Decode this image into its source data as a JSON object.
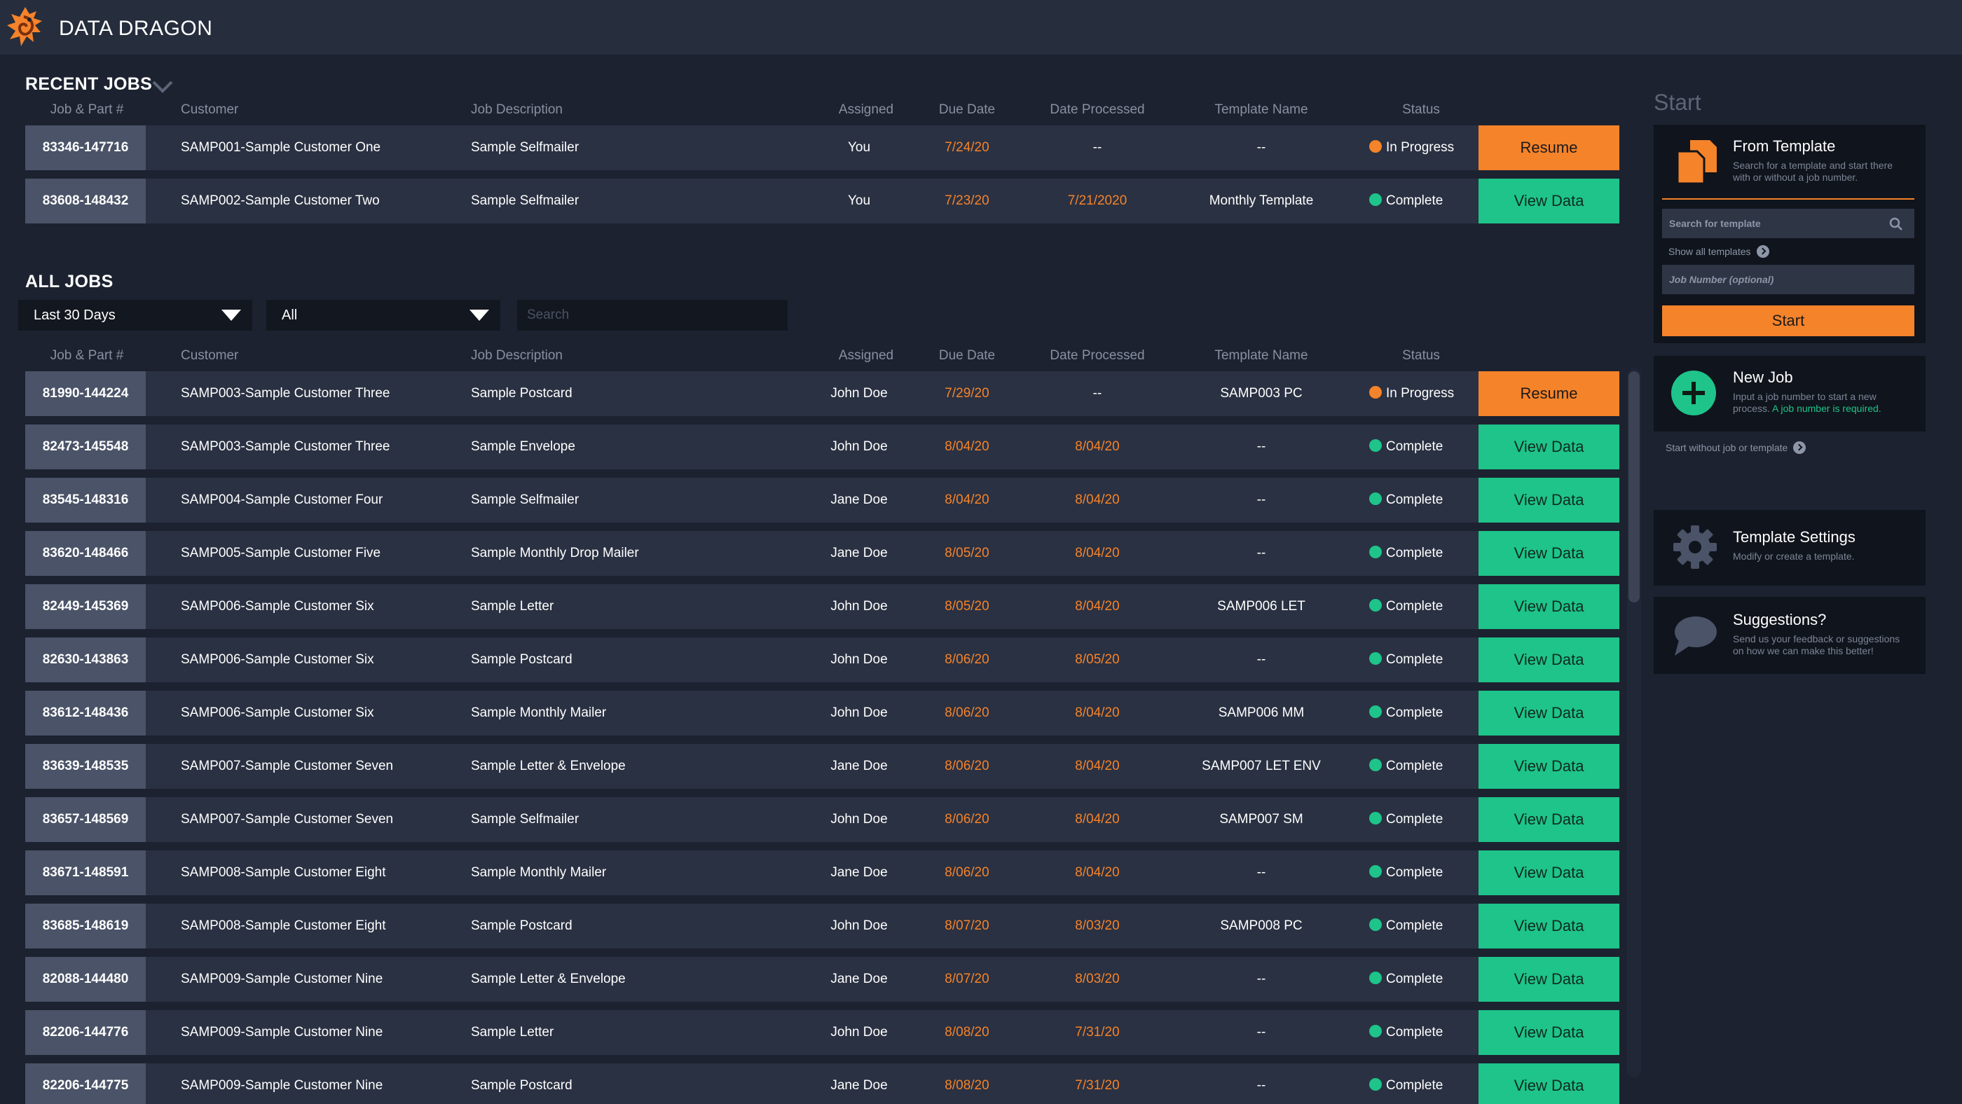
{
  "app": {
    "title": "DATA DRAGON"
  },
  "recent": {
    "title": "RECENT JOBS",
    "columns": [
      "Job & Part #",
      "Customer",
      "Job Description",
      "Assigned",
      "Due Date",
      "Date Processed",
      "Template Name",
      "Status"
    ],
    "rows": [
      {
        "job": "83346-147716",
        "customer": "SAMP001-Sample Customer One",
        "description": "Sample Selfmailer",
        "assigned": "You",
        "due": "7/24/20",
        "processed": "--",
        "template": "--",
        "status": "In Progress",
        "action": "Resume"
      },
      {
        "job": "83608-148432",
        "customer": "SAMP002-Sample Customer Two",
        "description": "Sample Selfmailer",
        "assigned": "You",
        "due": "7/23/20",
        "processed": "7/21/2020",
        "template": "Monthly Template",
        "status": "Complete",
        "action": "View Data"
      }
    ]
  },
  "all": {
    "title": "ALL JOBS",
    "filters": {
      "range": "Last 30 Days",
      "assigned": "All",
      "search_placeholder": "Search"
    },
    "columns": [
      "Job & Part #",
      "Customer",
      "Job Description",
      "Assigned",
      "Due Date",
      "Date Processed",
      "Template Name",
      "Status"
    ],
    "rows": [
      {
        "job": "81990-144224",
        "customer": "SAMP003-Sample Customer Three",
        "description": "Sample Postcard",
        "assigned": "John Doe",
        "due": "7/29/20",
        "processed": "--",
        "template": "SAMP003 PC",
        "status": "In Progress",
        "action": "Resume"
      },
      {
        "job": "82473-145548",
        "customer": "SAMP003-Sample Customer Three",
        "description": "Sample Envelope",
        "assigned": "John Doe",
        "due": "8/04/20",
        "processed": "8/04/20",
        "template": "--",
        "status": "Complete",
        "action": "View Data"
      },
      {
        "job": "83545-148316",
        "customer": "SAMP004-Sample Customer Four",
        "description": "Sample Selfmailer",
        "assigned": "Jane Doe",
        "due": "8/04/20",
        "processed": "8/04/20",
        "template": "--",
        "status": "Complete",
        "action": "View Data"
      },
      {
        "job": "83620-148466",
        "customer": "SAMP005-Sample Customer Five",
        "description": "Sample Monthly Drop Mailer",
        "assigned": "Jane Doe",
        "due": "8/05/20",
        "processed": "8/04/20",
        "template": "--",
        "status": "Complete",
        "action": "View Data"
      },
      {
        "job": "82449-145369",
        "customer": "SAMP006-Sample Customer Six",
        "description": "Sample Letter",
        "assigned": "John Doe",
        "due": "8/05/20",
        "processed": "8/04/20",
        "template": "SAMP006 LET",
        "status": "Complete",
        "action": "View Data"
      },
      {
        "job": "82630-143863",
        "customer": "SAMP006-Sample Customer Six",
        "description": "Sample Postcard",
        "assigned": "John Doe",
        "due": "8/06/20",
        "processed": "8/05/20",
        "template": "--",
        "status": "Complete",
        "action": "View Data"
      },
      {
        "job": "83612-148436",
        "customer": "SAMP006-Sample Customer Six",
        "description": "Sample Monthly Mailer",
        "assigned": "John Doe",
        "due": "8/06/20",
        "processed": "8/04/20",
        "template": "SAMP006 MM",
        "status": "Complete",
        "action": "View Data"
      },
      {
        "job": "83639-148535",
        "customer": "SAMP007-Sample Customer Seven",
        "description": "Sample Letter & Envelope",
        "assigned": "Jane Doe",
        "due": "8/06/20",
        "processed": "8/04/20",
        "template": "SAMP007 LET ENV",
        "status": "Complete",
        "action": "View Data"
      },
      {
        "job": "83657-148569",
        "customer": "SAMP007-Sample Customer Seven",
        "description": "Sample Selfmailer",
        "assigned": "John Doe",
        "due": "8/06/20",
        "processed": "8/04/20",
        "template": "SAMP007 SM",
        "status": "Complete",
        "action": "View Data"
      },
      {
        "job": "83671-148591",
        "customer": "SAMP008-Sample Customer Eight",
        "description": "Sample Monthly Mailer",
        "assigned": "Jane Doe",
        "due": "8/06/20",
        "processed": "8/04/20",
        "template": "--",
        "status": "Complete",
        "action": "View Data"
      },
      {
        "job": "83685-148619",
        "customer": "SAMP008-Sample Customer Eight",
        "description": "Sample Postcard",
        "assigned": "John Doe",
        "due": "8/07/20",
        "processed": "8/03/20",
        "template": "SAMP008 PC",
        "status": "Complete",
        "action": "View Data"
      },
      {
        "job": "82088-144480",
        "customer": "SAMP009-Sample Customer Nine",
        "description": "Sample Letter & Envelope",
        "assigned": "Jane Doe",
        "due": "8/07/20",
        "processed": "8/03/20",
        "template": "--",
        "status": "Complete",
        "action": "View Data"
      },
      {
        "job": "82206-144776",
        "customer": "SAMP009-Sample Customer Nine",
        "description": "Sample Letter",
        "assigned": "John Doe",
        "due": "8/08/20",
        "processed": "7/31/20",
        "template": "--",
        "status": "Complete",
        "action": "View Data"
      },
      {
        "job": "82206-144775",
        "customer": "SAMP009-Sample Customer Nine",
        "description": "Sample Postcard",
        "assigned": "Jane Doe",
        "due": "8/08/20",
        "processed": "7/31/20",
        "template": "--",
        "status": "Complete",
        "action": "View Data"
      }
    ]
  },
  "panel": {
    "title": "Start",
    "from_template": {
      "title": "From Template",
      "desc": "Search for a template and start there with or without a job number.",
      "search_placeholder": "Search for template",
      "show_all": "Show all templates",
      "job_placeholder": "Job Number (optional)",
      "start_label": "Start"
    },
    "new_job": {
      "title": "New Job",
      "desc": "Input a job number to start a new process.",
      "required": "A job number is required."
    },
    "start_without": "Start without job or template",
    "template_settings": {
      "title": "Template Settings",
      "desc": "Modify or create a template."
    },
    "suggestions": {
      "title": "Suggestions?",
      "desc": "Send us your feedback or suggestions on how we can make this better!"
    }
  },
  "colors": {
    "accent_orange": "#f5832a",
    "accent_green": "#1ec48a",
    "background": "#1c2230",
    "row": "#2a3142",
    "job_cell": "#4a5367",
    "panel": "#10141c"
  },
  "icons": [
    "dragon-logo",
    "chevron-down-icon",
    "caret-down-icon",
    "search-icon",
    "documents-icon",
    "arrow-right-circle-icon",
    "plus-circle-icon",
    "gear-icon",
    "chat-bubble-icon"
  ]
}
